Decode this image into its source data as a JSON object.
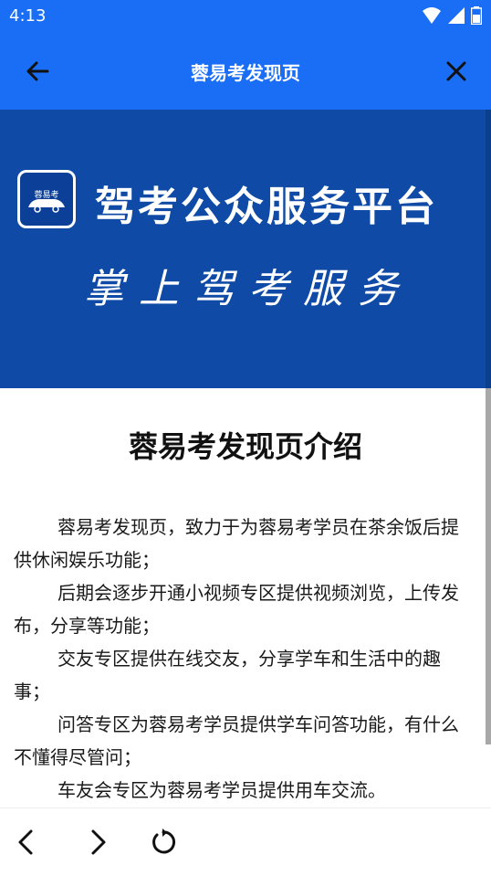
{
  "status": {
    "time": "4:13",
    "icons": [
      "wifi-icon",
      "signal-icon",
      "battery-icon"
    ]
  },
  "header": {
    "title": "蓉易考发现页",
    "back_icon": "arrow-left-icon",
    "close_icon": "close-icon",
    "background": "#1a6ef5"
  },
  "banner": {
    "logo_text": "蓉易考",
    "platform_name": "驾考公众服务平台",
    "slogan": "掌上驾考服务",
    "background": "#0e4aa6"
  },
  "article": {
    "title": "蓉易考发现页介绍",
    "paragraphs": [
      "蓉易考发现页，致力于为蓉易考学员在茶余饭后提供休闲娱乐功能；",
      "后期会逐步开通小视频专区提供视频浏览，上传发布，分享等功能；",
      "交友专区提供在线交友，分享学车和生活中的趣事；",
      "问答专区为蓉易考学员提供学车问答功能，有什么不懂得尽管问；",
      "车友会专区为蓉易考学员提供用车交流。"
    ]
  },
  "bottom_nav": {
    "icons": [
      "chevron-left-icon",
      "chevron-right-icon",
      "refresh-icon"
    ]
  }
}
